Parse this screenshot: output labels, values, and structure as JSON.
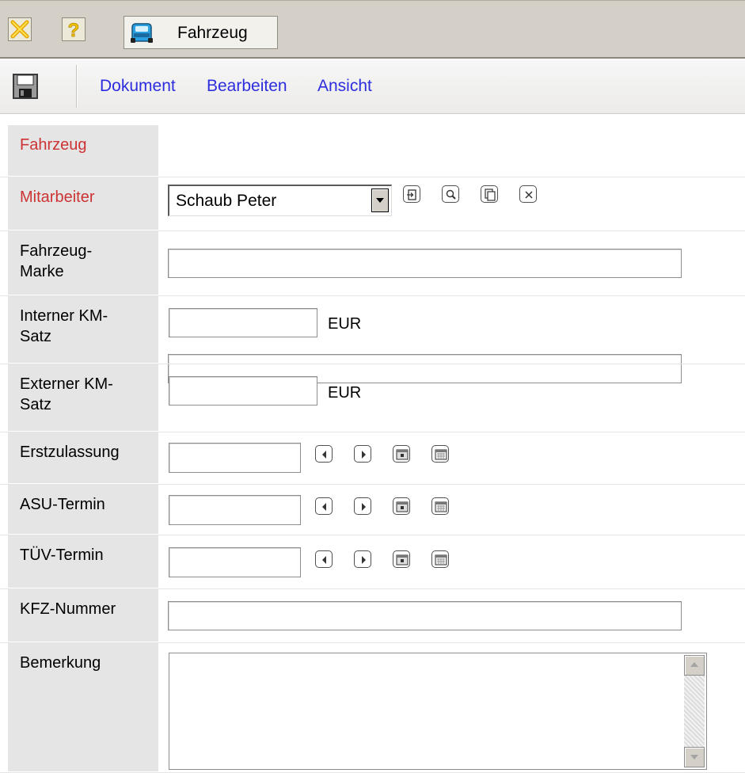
{
  "window": {
    "tab_title": "Fahrzeug"
  },
  "menu": {
    "items": [
      "Dokument",
      "Bearbeiten",
      "Ansicht"
    ]
  },
  "form": {
    "fahrzeug": {
      "label": "Fahrzeug",
      "value": ""
    },
    "mitarbeiter": {
      "label": "Mitarbeiter",
      "value": "Schaub Peter"
    },
    "marke": {
      "label": "Fahrzeug-\nMarke",
      "value": ""
    },
    "km_intern": {
      "label": "Interner KM-\nSatz",
      "value": "",
      "unit": "EUR"
    },
    "km_extern": {
      "label": "Externer KM-\nSatz",
      "value": "",
      "unit": "EUR"
    },
    "erstzulassung": {
      "label": "Erstzulassung",
      "value": ""
    },
    "asu": {
      "label": "ASU-Termin",
      "value": ""
    },
    "tuev": {
      "label": "TÜV-Termin",
      "value": ""
    },
    "kfz": {
      "label": "KFZ-Nummer",
      "value": ""
    },
    "bemerkung": {
      "label": "Bemerkung",
      "value": ""
    }
  },
  "colors": {
    "required_label": "#cc3333",
    "menu_link": "#2d2de0",
    "label_bg": "#e5e5e5",
    "chrome_bg": "#d4d0c8"
  },
  "icons": {
    "close": "close-icon",
    "help": "help-icon",
    "car": "car-icon",
    "save": "save-icon",
    "mitarbeiter_actions": [
      "open-record-icon",
      "search-icon",
      "copy-icon",
      "clear-icon"
    ],
    "date_actions": [
      "prev-day-icon",
      "next-day-icon",
      "today-icon",
      "calendar-icon"
    ]
  }
}
